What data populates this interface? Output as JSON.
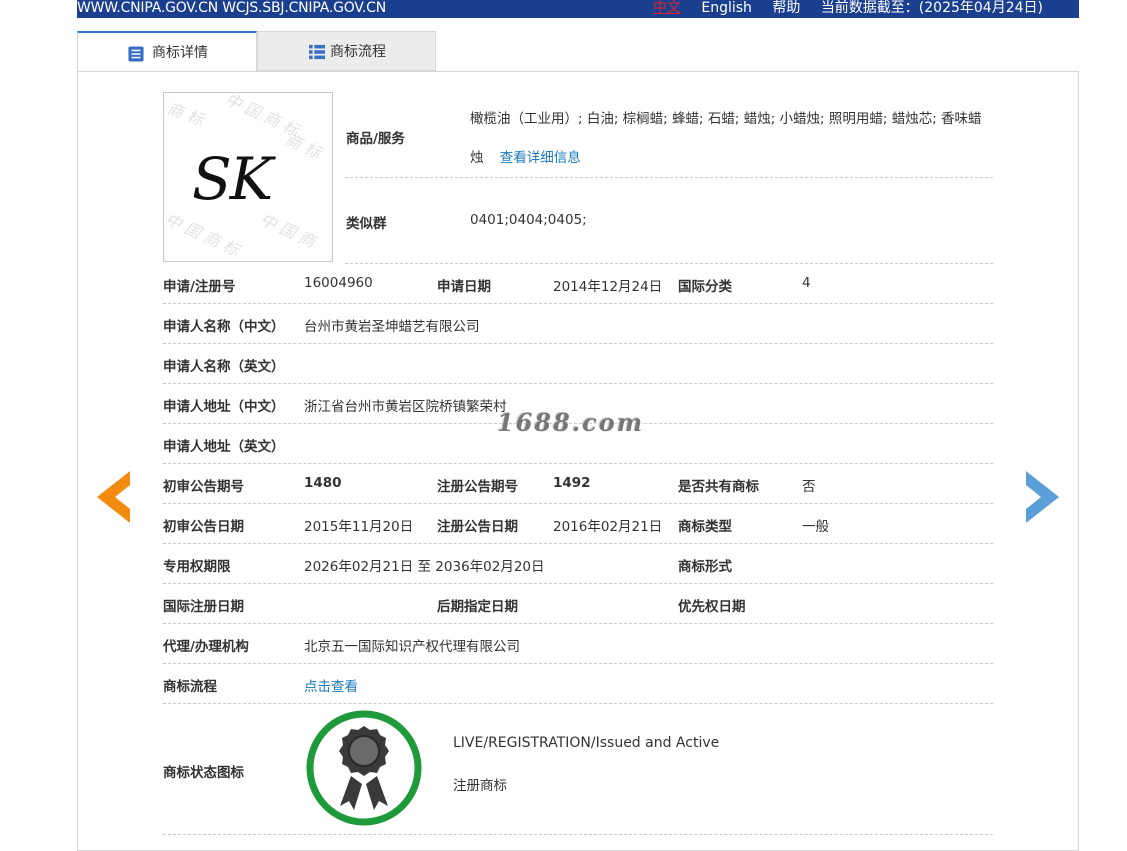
{
  "topbar": {
    "site": "WWW.CNIPA.GOV.CN WCJS.SBJ.CNIPA.GOV.CN",
    "lang_zh": "中文",
    "lang_en": "English",
    "help": "帮助",
    "data_date": "当前数据截至：(2025年04月24日)"
  },
  "tabs": [
    {
      "label": "商标详情",
      "icon": "list-icon",
      "active": true
    },
    {
      "label": "商标流程",
      "icon": "grid-list-icon",
      "active": false
    }
  ],
  "mark": {
    "image_text": "SK",
    "image_watermark": "中国商标"
  },
  "goods": {
    "label": "商品/服务",
    "value": "橄榄油（工业用）; 白油; 棕榈蜡; 蜂蜡; 石蜡; 蜡烛; 小蜡烛; 照明用蜡; 蜡烛芯; 香味蜡烛",
    "more_link": "查看详细信息"
  },
  "similar_group": {
    "label": "类似群",
    "value": "0401;0404;0405;"
  },
  "fields": {
    "reg_no": {
      "label": "申请/注册号",
      "value": "16004960"
    },
    "app_date": {
      "label": "申请日期",
      "value": "2014年12月24日"
    },
    "intl_class": {
      "label": "国际分类",
      "value": "4"
    },
    "applicant_cn": {
      "label": "申请人名称（中文）",
      "value": "台州市黄岩圣坤蜡艺有限公司"
    },
    "applicant_en": {
      "label": "申请人名称（英文）",
      "value": ""
    },
    "address_cn": {
      "label": "申请人地址（中文）",
      "value": "浙江省台州市黄岩区院桥镇繁荣村"
    },
    "address_en": {
      "label": "申请人地址（英文）",
      "value": ""
    },
    "prelim_pub_no": {
      "label": "初审公告期号",
      "value": "1480"
    },
    "reg_pub_no": {
      "label": "注册公告期号",
      "value": "1492"
    },
    "shared": {
      "label": "是否共有商标",
      "value": "否"
    },
    "prelim_pub_date": {
      "label": "初审公告日期",
      "value": "2015年11月20日"
    },
    "reg_pub_date": {
      "label": "注册公告日期",
      "value": "2016年02月21日"
    },
    "mark_type": {
      "label": "商标类型",
      "value": "一般"
    },
    "exclusive_term": {
      "label": "专用权期限",
      "value": "2026年02月21日 至 2036年02月20日"
    },
    "mark_form": {
      "label": "商标形式",
      "value": ""
    },
    "intl_reg_date": {
      "label": "国际注册日期",
      "value": ""
    },
    "later_designation_date": {
      "label": "后期指定日期",
      "value": ""
    },
    "priority_date": {
      "label": "优先权日期",
      "value": ""
    },
    "agency": {
      "label": "代理/办理机构",
      "value": "北京五一国际知识产权代理有限公司"
    },
    "flow": {
      "label": "商标流程",
      "link": "点击查看"
    },
    "status_icon": {
      "label": "商标状态图标"
    }
  },
  "status": {
    "title": "LIVE/REGISTRATION/Issued and Active",
    "subtitle": "注册商标",
    "badge_icon": "award-ribbon-icon",
    "badge_color": "#1f9a3a"
  },
  "watermark": {
    "text": "1688.com",
    "bg_chars": [
      "中",
      "国",
      "商",
      "标"
    ]
  },
  "nav": {
    "prev_icon": "arrow-left-icon",
    "next_icon": "arrow-right-icon",
    "prev_color": "#f28c10",
    "next_color": "#5b9fd8"
  }
}
